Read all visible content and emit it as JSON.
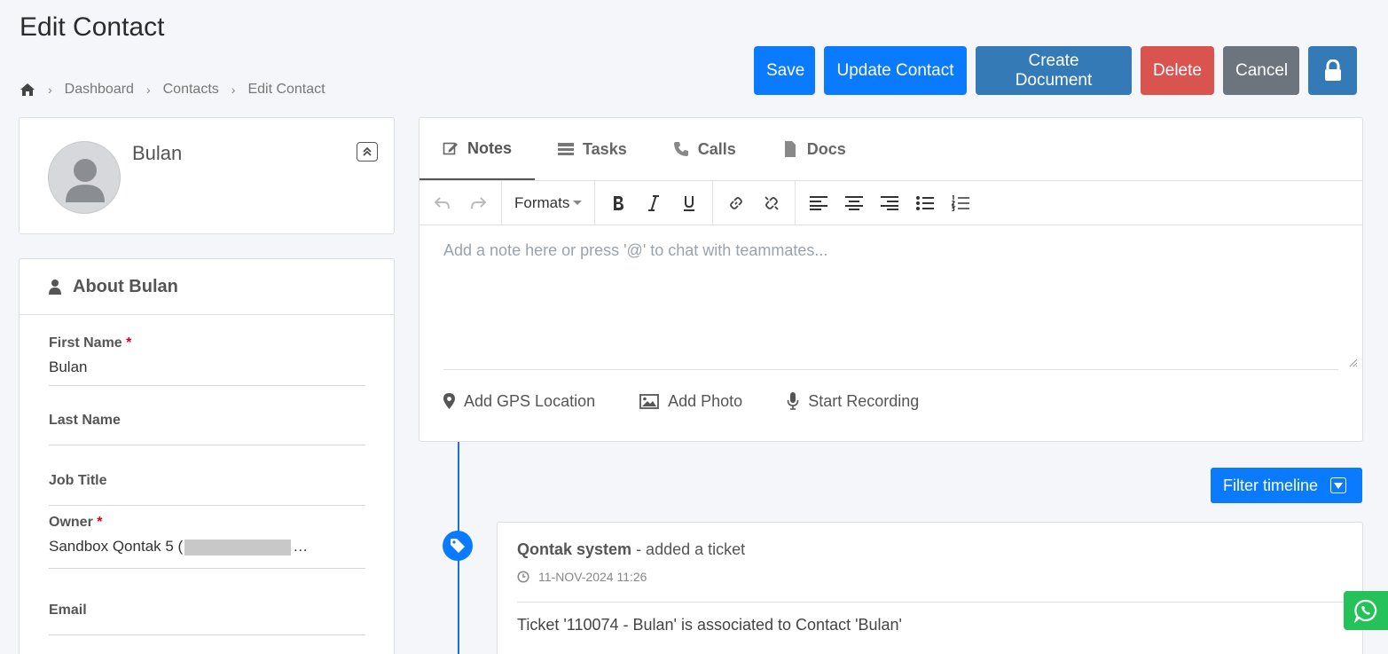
{
  "page": {
    "title": "Edit Contact"
  },
  "breadcrumb": {
    "items": [
      "Dashboard",
      "Contacts",
      "Edit Contact"
    ]
  },
  "actions": {
    "save": "Save",
    "update": "Update Contact",
    "create_doc": "Create Document",
    "delete": "Delete",
    "cancel": "Cancel"
  },
  "profile": {
    "name": "Bulan"
  },
  "about": {
    "title": "About Bulan",
    "fields": {
      "first_name": {
        "label": "First Name",
        "required": "*",
        "value": "Bulan"
      },
      "last_name": {
        "label": "Last Name",
        "value": ""
      },
      "job_title": {
        "label": "Job Title",
        "value": ""
      },
      "owner": {
        "label": "Owner",
        "required": "*",
        "value_prefix": "Sandbox Qontak 5 (",
        "value_suffix": "…"
      },
      "email": {
        "label": "Email",
        "value": ""
      }
    }
  },
  "tabs": [
    "Notes",
    "Tasks",
    "Calls",
    "Docs"
  ],
  "toolbar": {
    "formats": "Formats"
  },
  "editor": {
    "placeholder": "Add a note here or press '@' to chat with teammates..."
  },
  "attachments": {
    "gps": "Add GPS Location",
    "photo": "Add Photo",
    "record": "Start Recording"
  },
  "timeline": {
    "filter": "Filter timeline",
    "entries": [
      {
        "author": "Qontak system",
        "action": " - added a ticket",
        "time": "11-NOV-2024 11:26",
        "body": "Ticket '110074 - Bulan' is associated to Contact 'Bulan'"
      }
    ]
  },
  "colors": {
    "primary": "#0a7bff",
    "secondary_blue": "#337ab7",
    "danger": "#d9534f",
    "muted": "#6c757d",
    "whatsapp": "#25c25a"
  }
}
